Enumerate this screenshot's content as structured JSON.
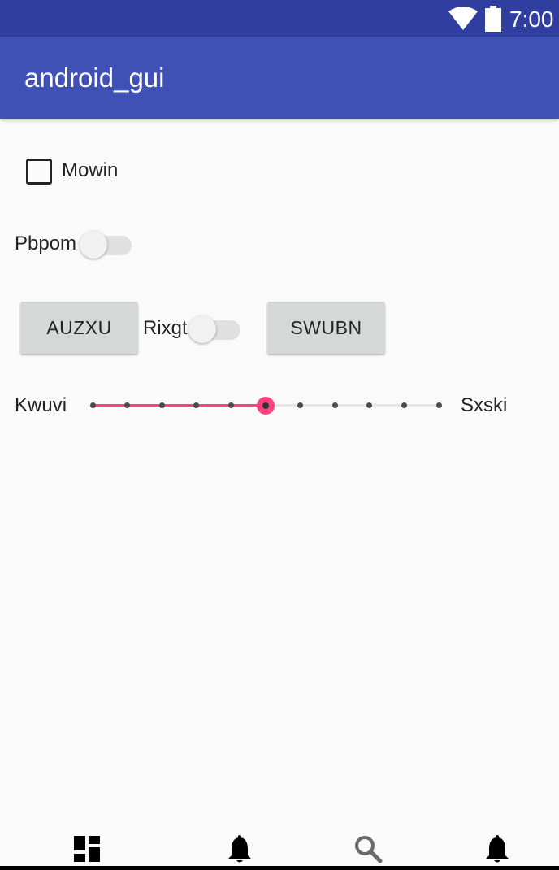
{
  "status_bar": {
    "time": "7:00",
    "icons": [
      "wifi-icon",
      "battery-icon"
    ]
  },
  "app_bar": {
    "title": "android_gui"
  },
  "checkbox": {
    "label": "Mowin",
    "checked": false
  },
  "switch1": {
    "label": "Pbpom",
    "on": false
  },
  "row3": {
    "button1_label": "AUZXU",
    "switch_label": "Rixgt",
    "switch_on": false,
    "button2_label": "SWUBN"
  },
  "seekbar": {
    "left_label": "Kwuvi",
    "right_label": "Sxski",
    "value": 5,
    "max": 10
  },
  "bottom_nav": {
    "items": [
      "dashboard-icon",
      "bell-icon",
      "search-icon",
      "bell-icon"
    ]
  },
  "colors": {
    "primary": "#3f51b5",
    "primary_dark": "#303f9f",
    "accent": "#ff4081"
  }
}
